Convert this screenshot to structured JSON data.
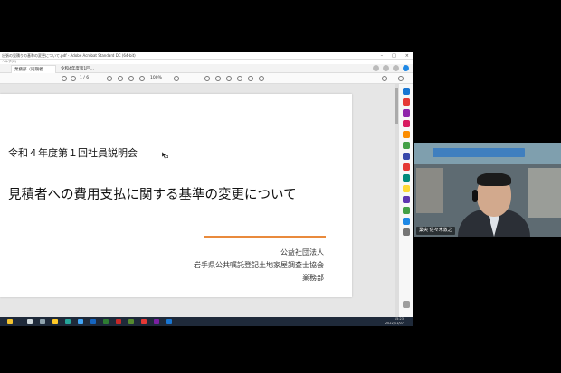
{
  "window": {
    "title": "出張の見積りの基準の変更について.pdf - Adobe Acrobat Standard DC (64-bit)",
    "menu": "ヘルプ(H)",
    "win_buttons": [
      "–",
      "□",
      "×"
    ]
  },
  "tabs": [
    {
      "label": "業務部（同期者..."
    },
    {
      "label": "令和4年度第1回..."
    }
  ],
  "toolbar": {
    "page_indicator": "1 / 6",
    "zoom": "100%"
  },
  "document": {
    "subtitle": "令和４年度第１回社員説明会",
    "title": "見積者への費用支払に関する基準の変更について",
    "org_line1": "公益社団法人",
    "org_line2": "岩手県公共嘱託登記土地家屋調査士協会",
    "org_line3": "業務部",
    "accent_color": "#e98a3c"
  },
  "taskbar": {
    "time": "15:23",
    "date": "2022/11/07"
  },
  "camera": {
    "name_label": "業央 佐々木敦之"
  }
}
